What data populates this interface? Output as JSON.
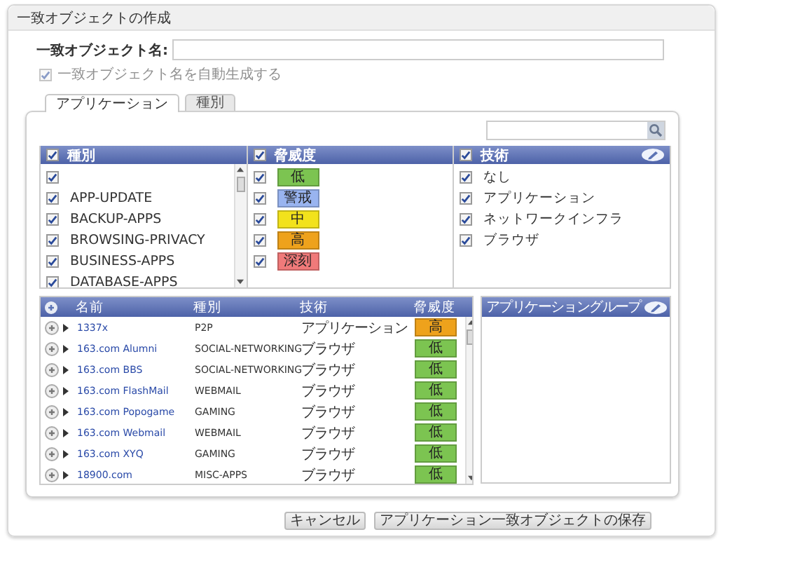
{
  "window": {
    "title": "一致オブジェクトの作成"
  },
  "name_field": {
    "label": "一致オブジェクト名:"
  },
  "auto_name": {
    "label": "一致オブジェクト名を自動生成する",
    "checked": true,
    "disabled": true
  },
  "tabs": [
    {
      "label": "アプリケーション",
      "selected": true
    },
    {
      "label": "種別",
      "selected": false
    }
  ],
  "filters": [
    {
      "title": "種別",
      "checked": true,
      "kind": "plain",
      "items": [
        {
          "checked": true
        },
        {
          "label": "APP-UPDATE",
          "checked": true
        },
        {
          "label": "BACKUP-APPS",
          "checked": true
        },
        {
          "label": "BROWSING-PRIVACY",
          "checked": true
        },
        {
          "label": "BUSINESS-APPS",
          "checked": true
        },
        {
          "label": "DATABASE-APPS",
          "checked": true
        }
      ]
    },
    {
      "title": "脅威度",
      "checked": true,
      "kind": "badge",
      "items": [
        {
          "label": "低",
          "checked": true,
          "color": "#7cc451"
        },
        {
          "label": "警戒",
          "checked": true,
          "color": "#99b4f0"
        },
        {
          "label": "中",
          "checked": true,
          "color": "#f2e21c"
        },
        {
          "label": "高",
          "checked": true,
          "color": "#eea21c"
        },
        {
          "label": "深刻",
          "checked": true,
          "color": "#f07a7a"
        }
      ]
    },
    {
      "title": "技術",
      "checked": true,
      "kind": "plain",
      "items": [
        {
          "label": "なし",
          "checked": true
        },
        {
          "label": "アプリケーション",
          "checked": true
        },
        {
          "label": "ネットワークインフラ",
          "checked": true
        },
        {
          "label": "ブラウザ",
          "checked": true
        }
      ]
    }
  ],
  "table": {
    "columns": [
      "名前",
      "種別",
      "技術",
      "脅威度"
    ],
    "rows": [
      {
        "name": "1337x",
        "category": "P2P",
        "technology": "アプリケーション",
        "threat": "高",
        "color": "#eea21c"
      },
      {
        "name": "163.com Alumni",
        "category": "SOCIAL-NETWORKING",
        "technology": "ブラウザ",
        "threat": "低",
        "color": "#7cc451"
      },
      {
        "name": "163.com BBS",
        "category": "SOCIAL-NETWORKING",
        "technology": "ブラウザ",
        "threat": "低",
        "color": "#7cc451"
      },
      {
        "name": "163.com FlashMail",
        "category": "WEBMAIL",
        "technology": "ブラウザ",
        "threat": "低",
        "color": "#7cc451"
      },
      {
        "name": "163.com Popogame",
        "category": "GAMING",
        "technology": "ブラウザ",
        "threat": "低",
        "color": "#7cc451"
      },
      {
        "name": "163.com Webmail",
        "category": "WEBMAIL",
        "technology": "ブラウザ",
        "threat": "低",
        "color": "#7cc451"
      },
      {
        "name": "163.com XYQ",
        "category": "GAMING",
        "technology": "ブラウザ",
        "threat": "低",
        "color": "#7cc451"
      },
      {
        "name": "18900.com",
        "category": "MISC-APPS",
        "technology": "ブラウザ",
        "threat": "低",
        "color": "#7cc451"
      }
    ]
  },
  "group_panel": {
    "title": "アプリケーショングループ"
  },
  "buttons": [
    "キャンセル",
    "アプリケーション一致オブジェクトの保存"
  ]
}
